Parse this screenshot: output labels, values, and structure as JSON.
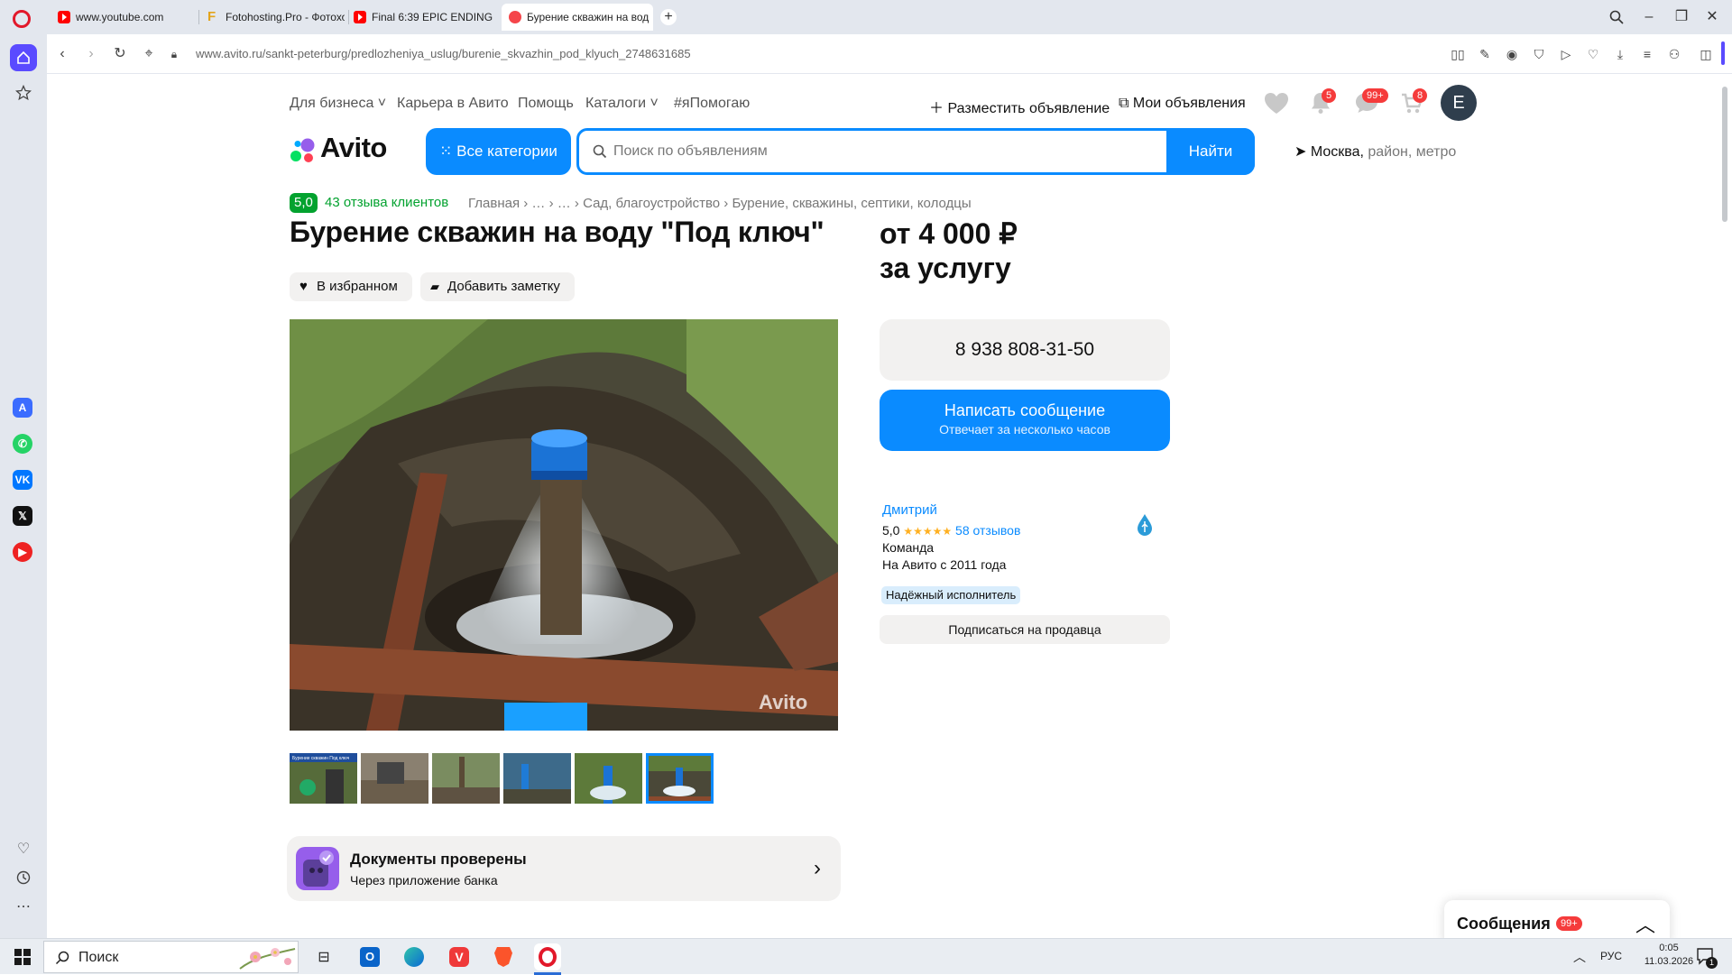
{
  "browser": {
    "tabs": [
      {
        "title": "www.youtube.com",
        "icon": "youtube-icon"
      },
      {
        "title": "Fotohosting.Pro - Фотохо",
        "icon": "fotohosting-icon"
      },
      {
        "title": "Final 6:39 EPIC ENDING N",
        "icon": "youtube-icon"
      },
      {
        "title": "Бурение скважин на вод",
        "icon": "avito-icon",
        "active": true
      }
    ],
    "url_host": "www.avito.ru",
    "url_path": "/sankt-peterburg/predlozheniya_uslug/burenie_skvazhin_pod_klyuch_2748631685"
  },
  "header": {
    "links": [
      "Для бизнеса",
      "Карьера в Авито",
      "Помощь",
      "Каталоги",
      "#яПомогаю"
    ],
    "post_ad": "Разместить объявление",
    "my_ads": "Мои объявления",
    "notifications_badge": "5",
    "messages_badge": "99+",
    "cart_badge": "8",
    "avatar_letter": "E",
    "logo_text": "Avito",
    "all_categories": "Все категории",
    "search_placeholder": "Поиск по объявлениям",
    "search_button": "Найти",
    "location_city": "Москва,",
    "location_rest": " район, метро"
  },
  "listing": {
    "rating": "5,0",
    "reviews_link": "43 отзыва клиентов",
    "breadcrumbs": "Главная  ›  …  ›  …  ›  Сад, благоустройство  ›  Бурение, скважины, септики, колодцы",
    "title": "Бурение скважин на воду \"Под ключ\"",
    "price_line1": "от 4 000 ₽",
    "price_line2": "за услугу",
    "favorite_button": "В избранном",
    "note_button": "Добавить заметку",
    "photo_watermark": "Avito",
    "thumb_caption": "Бурение скважин Под ключ",
    "docs_title": "Документы проверены",
    "docs_subtitle": "Через приложение банка"
  },
  "contact": {
    "phone": "8 938 808-31-50",
    "message_button": "Написать сообщение",
    "message_subtitle": "Отвечает за несколько часов"
  },
  "seller": {
    "name": "Дмитрий",
    "rating": "5,0",
    "stars": "★★★★★",
    "reviews": "58 отзывов",
    "type": "Команда",
    "since": "На Авито с 2011 года",
    "trust_badge": "Надёжный исполнитель",
    "subscribe": "Подписаться на продавца"
  },
  "messages_panel": {
    "title": "Сообщения",
    "badge": "99+"
  },
  "taskbar": {
    "search_placeholder": "Поиск",
    "lang": "РУС",
    "time": "0:05",
    "date": "11.03.2026",
    "notif_count": "1"
  },
  "colors": {
    "accent": "#0a8bff",
    "green": "#03a22f",
    "badge_red": "#f53b3b",
    "opera_red": "#e2182a"
  }
}
